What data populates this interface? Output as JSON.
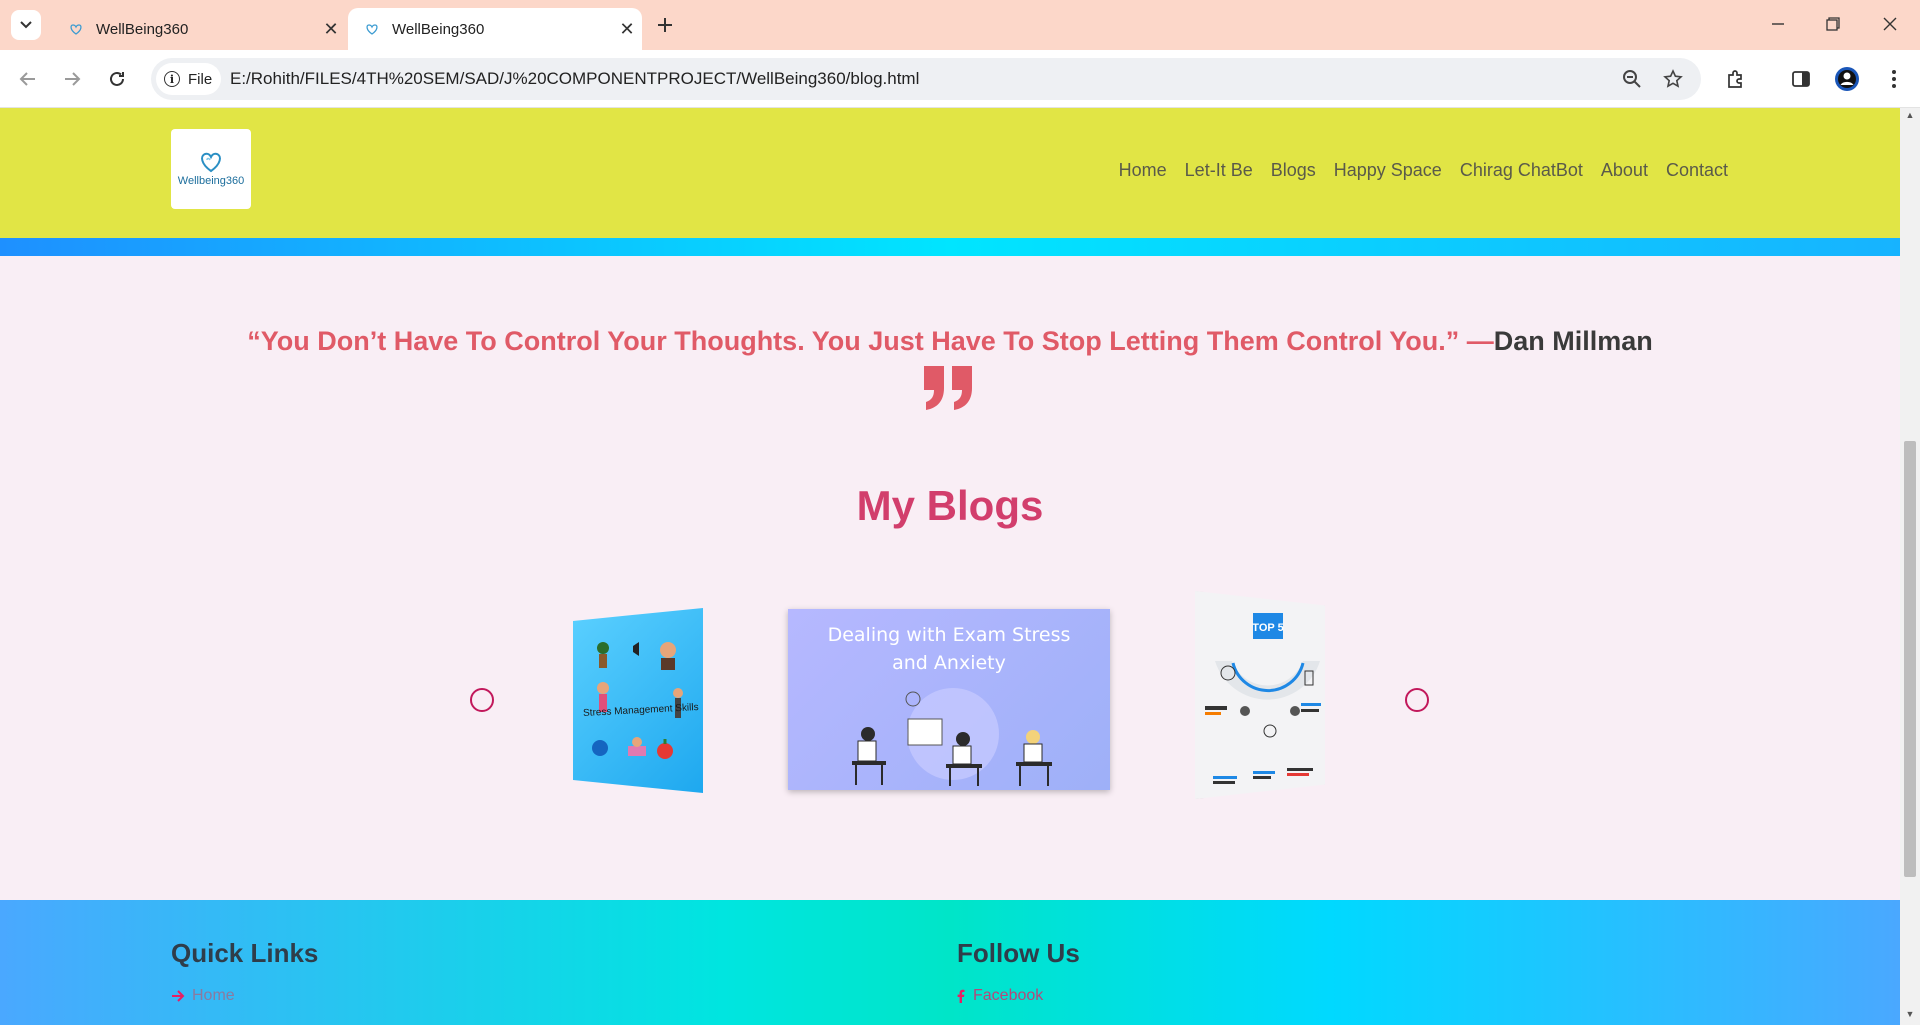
{
  "browser": {
    "tabs": [
      {
        "title": "WellBeing360",
        "active": false
      },
      {
        "title": "WellBeing360",
        "active": true
      }
    ],
    "site_chip": "File",
    "url": "E:/Rohith/FILES/4TH%20SEM/SAD/J%20COMPONENTPROJECT/WellBeing360/blog.html"
  },
  "site": {
    "logo_text": "Wellbeing360",
    "nav": [
      "Home",
      "Let-It Be",
      "Blogs",
      "Happy Space",
      "Chirag ChatBot",
      "About",
      "Contact"
    ]
  },
  "quote": {
    "text": "“You Don’t Have To Control Your Thoughts. You Just Have To Stop Letting Them Control You.” —",
    "author": "Dan Millman"
  },
  "blogs": {
    "title": "My Blogs",
    "slides": [
      {
        "caption": "Stress Management Skills"
      },
      {
        "caption": "Dealing with Exam Stress and Anxiety"
      },
      {
        "caption": "TOP 5"
      }
    ]
  },
  "footer": {
    "quick_links_title": "Quick Links",
    "quick_links": [
      "Home"
    ],
    "follow_title": "Follow Us",
    "follow_links": [
      "Facebook"
    ]
  },
  "colors": {
    "header_bg": "#e1e545",
    "accent": "#d23e6c",
    "quote_color": "#e05a67",
    "tabbar_bg": "#fcd7c9"
  }
}
